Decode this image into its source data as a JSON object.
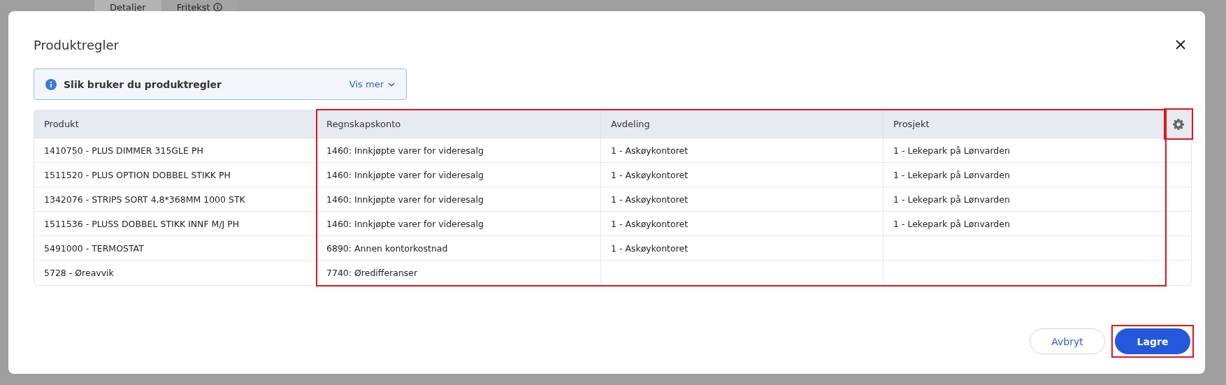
{
  "background": {
    "tabs": [
      {
        "label": "Detaljer",
        "selected": true
      },
      {
        "label": "Fritekst",
        "selected": false
      }
    ]
  },
  "dialog": {
    "title": "Produktregler",
    "info": {
      "text": "Slik bruker du produktregler",
      "link": "Vis mer"
    },
    "table": {
      "columns": [
        {
          "label": "Produkt",
          "highlighted": false
        },
        {
          "label": "Regnskapskonto",
          "highlighted": true
        },
        {
          "label": "Avdeling",
          "highlighted": true
        },
        {
          "label": "Prosjekt",
          "highlighted": true
        }
      ],
      "settings_highlighted": true,
      "rows": [
        [
          "1410750 - PLUS DIMMER 315GLE PH",
          "1460: Innkjøpte varer for videresalg",
          "1 - Askøykontoret",
          "1 - Lekepark på Lønvarden"
        ],
        [
          "1511520 - PLUS OPTION DOBBEL STIKK PH",
          "1460: Innkjøpte varer for videresalg",
          "1 - Askøykontoret",
          "1 - Lekepark på Lønvarden"
        ],
        [
          "1342076 - STRIPS SORT 4,8*368MM 1000 STK",
          "1460: Innkjøpte varer for videresalg",
          "1 - Askøykontoret",
          "1 - Lekepark på Lønvarden"
        ],
        [
          "1511536 - PLUSS DOBBEL STIKK INNF M/J PH",
          "1460: Innkjøpte varer for videresalg",
          "1 - Askøykontoret",
          "1 - Lekepark på Lønvarden"
        ],
        [
          "5491000 - TERMOSTAT",
          "6890: Annen kontorkostnad",
          "1 - Askøykontoret",
          ""
        ],
        [
          "5728 - Øreavvik",
          "7740: Øredifferanser",
          "",
          ""
        ]
      ]
    },
    "buttons": [
      {
        "label": "Avbryt",
        "kind": "secondary",
        "highlighted": false
      },
      {
        "label": "Lagre",
        "kind": "primary",
        "highlighted": true
      }
    ]
  }
}
